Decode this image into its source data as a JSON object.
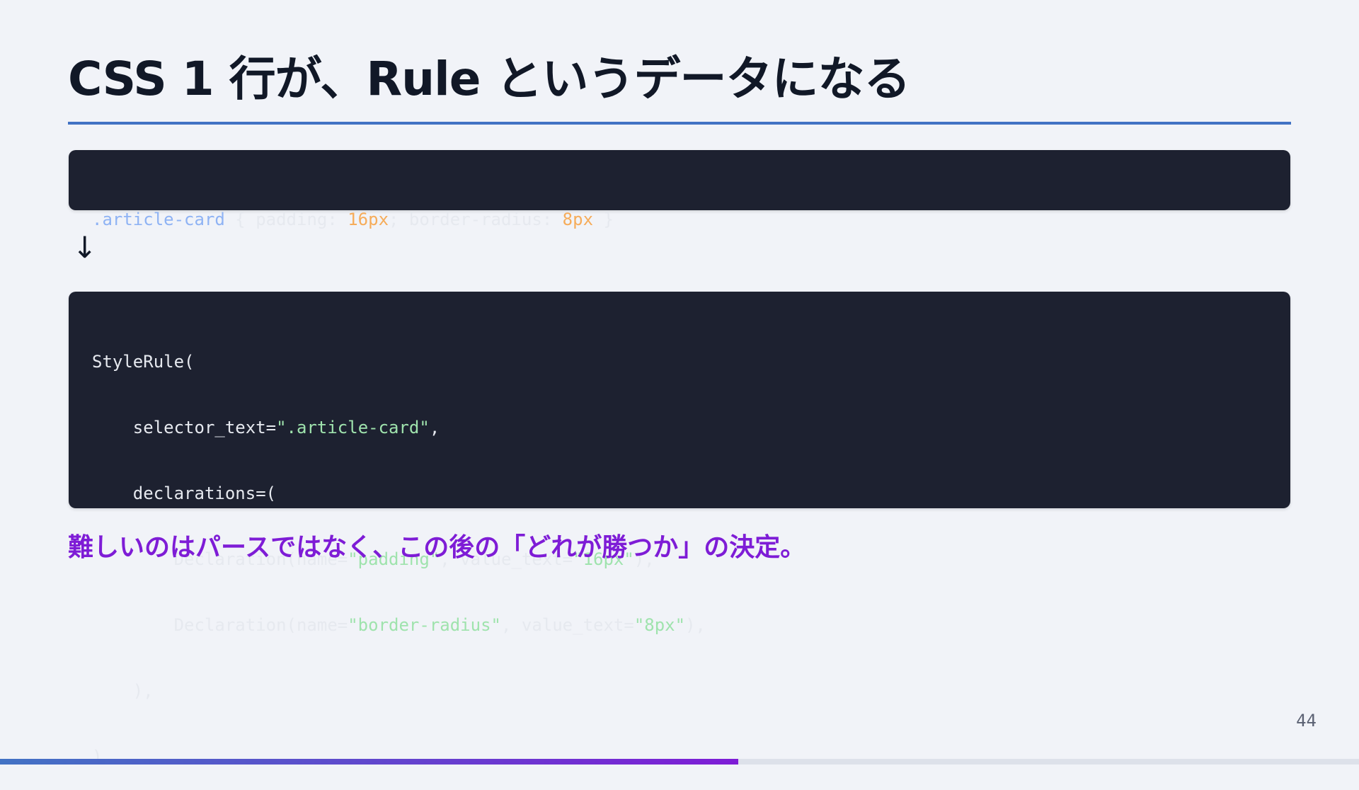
{
  "slide": {
    "title": "CSS 1 行が、Rule というデータになる",
    "page_number": "44",
    "progress": 0.543
  },
  "code_input": {
    "tokens": [
      ".article-card",
      " { padding: ",
      "16px",
      "; border-radius: ",
      "8px",
      " }"
    ]
  },
  "arrow": "↓",
  "code_output": {
    "lines": [
      [
        "StyleRule("
      ],
      [
        "    selector_text=",
        "\".article-card\"",
        ","
      ],
      [
        "    declarations=("
      ],
      [
        "        Declaration(name=",
        "\"padding\"",
        ", value_text=",
        "\"16px\"",
        "),"
      ],
      [
        "        Declaration(name=",
        "\"border-radius\"",
        ", value_text=",
        "\"8px\"",
        "),"
      ],
      [
        "    ),"
      ],
      [
        ")"
      ]
    ]
  },
  "takeaway": "難しいのはパースではなく、この後の「どれが勝つか」の決定。",
  "colors": {
    "background": "#f1f3f8",
    "accent_blue": "#4272c4",
    "accent_purple": "#7e1cd6",
    "code_bg": "#1d2130",
    "code_selector": "#8fb3f4",
    "code_number": "#f6ac5a",
    "code_string": "#9fe3ad"
  }
}
